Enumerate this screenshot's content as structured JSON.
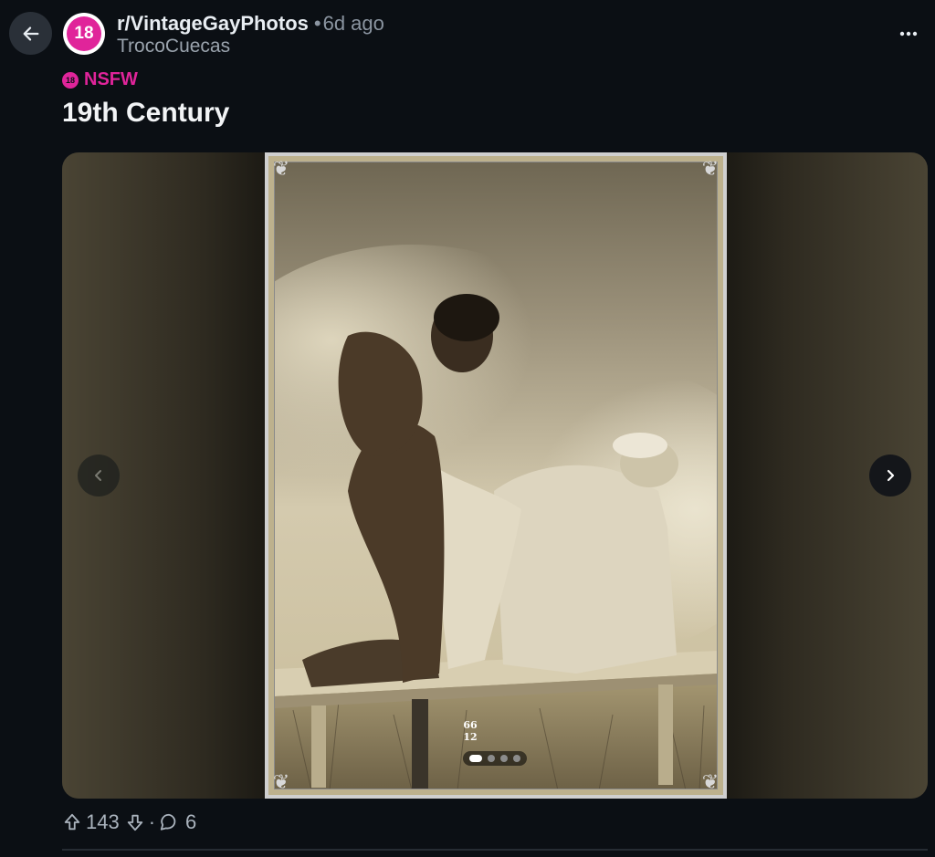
{
  "header": {
    "subreddit": "r/VintageGayPhotos",
    "separator": "•",
    "time": "6d ago",
    "author": "TrocoCuecas",
    "avatar_text": "18",
    "icons": {
      "back": "arrow-left-icon",
      "overflow": "more-horizontal-icon"
    }
  },
  "post": {
    "nsfw_badge_icon": "18",
    "nsfw_label": "NSFW",
    "title": "19th Century",
    "photo_caption_number": "66\n12"
  },
  "gallery": {
    "slide_count": 4,
    "active_slide": 1,
    "icons": {
      "prev": "chevron-left-icon",
      "next": "chevron-right-icon"
    }
  },
  "actions": {
    "upvotes": "143",
    "separator": "·",
    "comments": "6",
    "icons": {
      "upvote": "arrow-up-icon",
      "downvote": "arrow-down-icon",
      "comment": "comment-bubble-icon"
    }
  },
  "colors": {
    "background": "#0b0f14",
    "nsfw_accent": "#e0249a",
    "muted_text": "#8b95a1"
  }
}
